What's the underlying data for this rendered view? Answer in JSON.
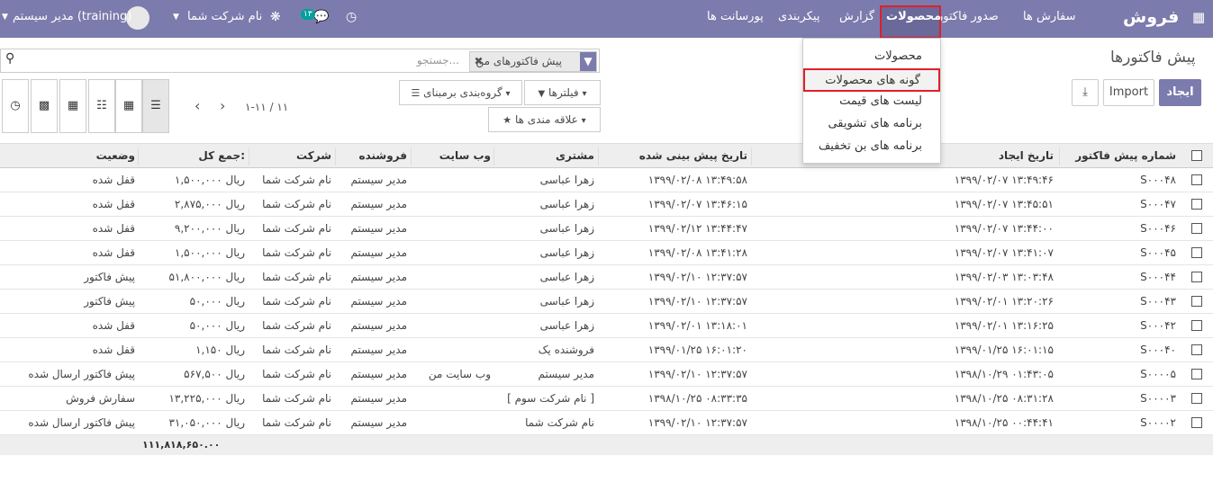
{
  "topbar": {
    "brand": "فروش",
    "apps_icon": "grid-icon",
    "menu": [
      "سفارش ها",
      "صدور فاکتور",
      "محصولات",
      "گزارش",
      "پیکربندی",
      "پورسانت ها"
    ],
    "activity_icon": "clock-icon",
    "messages_badge": "۱۳",
    "debug_icon": "bug-icon",
    "company": "نام شرکت شما",
    "user": "مدیر سیستم (training)"
  },
  "dropdown": {
    "items": [
      "محصولات",
      "گونه های محصولات",
      "لیست های قیمت",
      "برنامه های تشویقی",
      "برنامه های بن تخفیف"
    ]
  },
  "control": {
    "title": "پیش فاکتورها",
    "create": "ایجاد",
    "import": "Import",
    "download_icon": "download-icon",
    "search_placeholder": "جستجو...",
    "facet": "پیش فاکتورهای من",
    "filters": "فیلترها",
    "groupby": "گروه‌بندی برمبنای",
    "favorites": "علاقه مندی ها",
    "pager": "۱-۱۱ / ۱۱"
  },
  "table": {
    "columns": [
      "شماره پیش فاکتور",
      "تاریخ ایجاد",
      "تاریخ پیش بینی شده",
      "مشتری",
      "وب سایت",
      "فروشنده",
      "شرکت",
      "جمع کل:",
      "وضعیت"
    ],
    "rows": [
      [
        "S۰۰۰۴۸",
        "۱۳۹۹/۰۲/۰۷ ۱۳:۴۹:۴۶",
        "۱۳۹۹/۰۲/۰۸ ۱۳:۴۹:۵۸",
        "زهرا عباسی",
        "",
        "مدیر سیستم",
        "نام شرکت شما",
        "۱,۵۰۰,۰۰۰ ریال",
        "قفل شده"
      ],
      [
        "S۰۰۰۴۷",
        "۱۳۹۹/۰۲/۰۷ ۱۳:۴۵:۵۱",
        "۱۳۹۹/۰۲/۰۷ ۱۳:۴۶:۱۵",
        "زهرا عباسی",
        "",
        "مدیر سیستم",
        "نام شرکت شما",
        "۲,۸۷۵,۰۰۰ ریال",
        "قفل شده"
      ],
      [
        "S۰۰۰۴۶",
        "۱۳۹۹/۰۲/۰۷ ۱۳:۴۴:۰۰",
        "۱۳۹۹/۰۲/۱۲ ۱۳:۴۴:۴۷",
        "زهرا عباسی",
        "",
        "مدیر سیستم",
        "نام شرکت شما",
        "۹,۲۰۰,۰۰۰ ریال",
        "قفل شده"
      ],
      [
        "S۰۰۰۴۵",
        "۱۳۹۹/۰۲/۰۷ ۱۳:۴۱:۰۷",
        "۱۳۹۹/۰۲/۰۸ ۱۳:۴۱:۲۸",
        "زهرا عباسی",
        "",
        "مدیر سیستم",
        "نام شرکت شما",
        "۱,۵۰۰,۰۰۰ ریال",
        "قفل شده"
      ],
      [
        "S۰۰۰۴۴",
        "۱۳۹۹/۰۲/۰۳ ۱۳:۰۳:۴۸",
        "۱۳۹۹/۰۲/۱۰ ۱۲:۳۷:۵۷",
        "زهرا عباسی",
        "",
        "مدیر سیستم",
        "نام شرکت شما",
        "۵۱,۸۰۰,۰۰۰ ریال",
        "پیش فاکتور"
      ],
      [
        "S۰۰۰۴۳",
        "۱۳۹۹/۰۲/۰۱ ۱۳:۲۰:۲۶",
        "۱۳۹۹/۰۲/۱۰ ۱۲:۳۷:۵۷",
        "زهرا عباسی",
        "",
        "مدیر سیستم",
        "نام شرکت شما",
        "۵۰,۰۰۰ ریال",
        "پیش فاکتور"
      ],
      [
        "S۰۰۰۴۲",
        "۱۳۹۹/۰۲/۰۱ ۱۳:۱۶:۲۵",
        "۱۳۹۹/۰۲/۰۱ ۱۳:۱۸:۰۱",
        "زهرا عباسی",
        "",
        "مدیر سیستم",
        "نام شرکت شما",
        "۵۰,۰۰۰ ریال",
        "قفل شده"
      ],
      [
        "S۰۰۰۴۰",
        "۱۳۹۹/۰۱/۲۵ ۱۶:۰۱:۱۵",
        "۱۳۹۹/۰۱/۲۵ ۱۶:۰۱:۲۰",
        "فروشنده یک",
        "",
        "مدیر سیستم",
        "نام شرکت شما",
        "۱,۱۵۰ ریال",
        "قفل شده"
      ],
      [
        "S۰۰۰۰۵",
        "۱۳۹۸/۱۰/۲۹ ۰۱:۴۳:۰۵",
        "۱۳۹۹/۰۲/۱۰ ۱۲:۳۷:۵۷",
        "مدیر سیستم",
        "وب سایت من",
        "مدیر سیستم",
        "نام شرکت شما",
        "۵۶۷,۵۰۰ ریال",
        "پیش فاکتور ارسال شده"
      ],
      [
        "S۰۰۰۰۳",
        "۱۳۹۸/۱۰/۲۵ ۰۸:۳۱:۲۸",
        "۱۳۹۸/۱۰/۲۵ ۰۸:۳۳:۳۵",
        "[ نام شرکت سوم ]",
        "",
        "مدیر سیستم",
        "نام شرکت شما",
        "۱۳,۲۲۵,۰۰۰ ریال",
        "سفارش فروش"
      ],
      [
        "S۰۰۰۰۲",
        "۱۳۹۸/۱۰/۲۵ ۰۰:۴۴:۴۱",
        "۱۳۹۹/۰۲/۱۰ ۱۲:۳۷:۵۷",
        "نام شرکت شما",
        "",
        "مدیر سیستم",
        "نام شرکت شما",
        "۳۱,۰۵۰,۰۰۰ ریال",
        "پیش فاکتور ارسال شده"
      ]
    ],
    "total": "۱۱۱,۸۱۸,۶۵۰.۰۰"
  }
}
